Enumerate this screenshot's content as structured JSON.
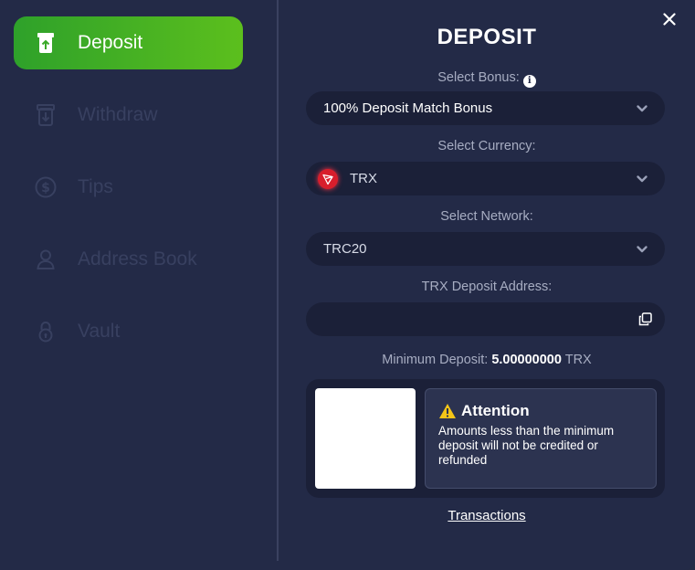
{
  "sidebar": {
    "items": [
      {
        "label": "Deposit",
        "icon": "deposit-icon",
        "active": true
      },
      {
        "label": "Withdraw",
        "icon": "withdraw-icon",
        "active": false
      },
      {
        "label": "Tips",
        "icon": "dollar-coin-icon",
        "active": false
      },
      {
        "label": "Address Book",
        "icon": "person-icon",
        "active": false
      },
      {
        "label": "Vault",
        "icon": "lock-icon",
        "active": false
      }
    ]
  },
  "modal": {
    "title": "DEPOSIT",
    "close_icon": "close-icon"
  },
  "bonus": {
    "label": "Select Bonus:",
    "value": "100% Deposit Match Bonus"
  },
  "currency": {
    "label": "Select Currency:",
    "value": "TRX",
    "icon": "tron-icon"
  },
  "network": {
    "label": "Select Network:",
    "value": "TRC20"
  },
  "address": {
    "label": "TRX Deposit Address:",
    "value": ""
  },
  "minimum": {
    "label": "Minimum Deposit:",
    "amount": "5.00000000",
    "unit": "TRX"
  },
  "attention": {
    "title": "Attention",
    "text": "Amounts less than the minimum deposit will not be credited or refunded"
  },
  "footer": {
    "transactions_link": "Transactions"
  },
  "colors": {
    "background": "#232a47",
    "input_bg": "#1b2038",
    "active_green": "#3fad25",
    "inactive_text": "#384060",
    "tron_red": "#d81e2c",
    "warning_yellow": "#f5c518"
  }
}
